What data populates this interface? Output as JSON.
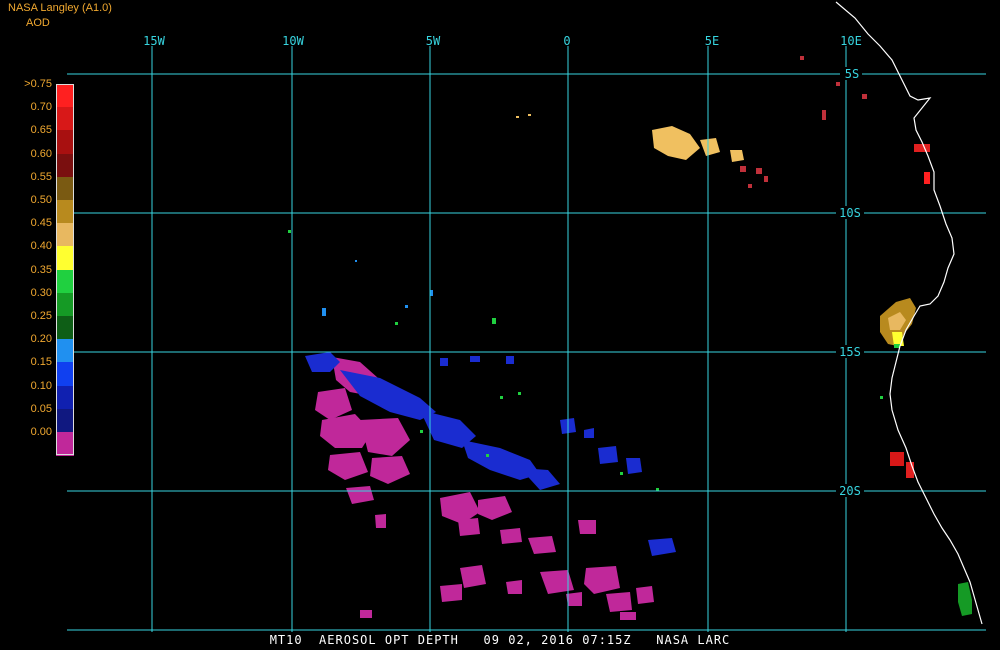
{
  "header": {
    "source": "NASA Langley (A1.0)",
    "product": "AOD"
  },
  "footer": {
    "caption": "MT10  AEROSOL OPT DEPTH   09 02, 2016 07:15Z   NASA LARC"
  },
  "colors": {
    "background": "#000000",
    "grid": "#37d5e0",
    "coast": "#ffffff",
    "label_orange": "#f0a830"
  },
  "colorbar": {
    "labels": [
      ">0.75",
      "0.70",
      "0.65",
      "0.60",
      "0.55",
      "0.50",
      "0.45",
      "0.40",
      "0.35",
      "0.30",
      "0.25",
      "0.20",
      "0.15",
      "0.10",
      "0.05",
      "0.00"
    ],
    "colors": [
      "#ff2020",
      "#d81818",
      "#a81010",
      "#7a0f0f",
      "#7a5a12",
      "#b88a1e",
      "#e8b860",
      "#ffff30",
      "#20d040",
      "#159a25",
      "#0e5e16",
      "#2090f0",
      "#1040f0",
      "#1020b0",
      "#101880",
      "#c0289a"
    ]
  },
  "map": {
    "lon_labels": [
      "15W",
      "10W",
      "5W",
      "0",
      "5E",
      "10E"
    ],
    "lat_labels": [
      "5S",
      "10S",
      "15S",
      "20S"
    ]
  }
}
